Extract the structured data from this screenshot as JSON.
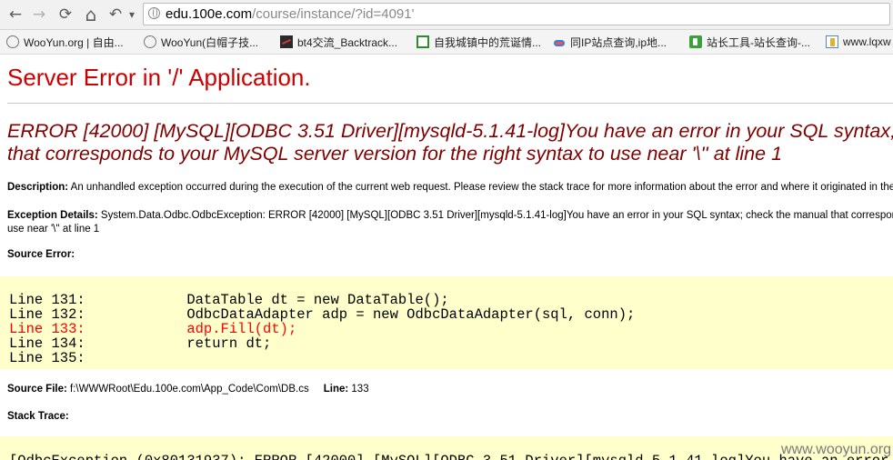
{
  "browser": {
    "url_host": "edu.100e.com",
    "url_path": "/course/instance/?id=4091'",
    "nav": {
      "back": "←",
      "forward": "→",
      "reload": "⟳",
      "home": "⌂",
      "history": "↶",
      "history_menu": "▾"
    },
    "bookmarks": [
      {
        "label": "WooYun.org | 自由...",
        "icon": "globe-icon"
      },
      {
        "label": "WooYun(白帽子技...",
        "icon": "globe-icon"
      },
      {
        "label": "bt4交流_Backtrack...",
        "icon": "bt-icon"
      },
      {
        "label": "自我城镇中的荒诞情...",
        "icon": "green-icon"
      },
      {
        "label": "同IP站点查询,ip地...",
        "icon": "cloud-icon"
      },
      {
        "label": "站长工具-站长查询-...",
        "icon": "tools-icon"
      },
      {
        "label": "www.lqxw",
        "icon": "book-icon"
      }
    ]
  },
  "page": {
    "title": "Server Error in '/' Application.",
    "error_line1": "ERROR [42000] [MySQL][ODBC 3.51 Driver][mysqld-5.1.41-log]You have an error in your SQL syntax; check the manual",
    "error_line2": "that corresponds to your MySQL server version for the right syntax to use near '\\'' at line 1",
    "description_label": "Description:",
    "description_text": " An unhandled exception occurred during the execution of the current web request. Please review the stack trace for more information about the error and where it originated in the code.",
    "exception_label": "Exception Details:",
    "exception_text1": " System.Data.Odbc.OdbcException: ERROR [42000] [MySQL][ODBC 3.51 Driver][mysqld-5.1.41-log]You have an error in your SQL syntax; check the manual that corresponds to your MySQL server version for the right syntax to",
    "exception_text2": "use near '\\'' at line 1",
    "source_error_label": "Source Error:",
    "code_lines": [
      {
        "text": "Line 131:            DataTable dt = new DataTable();",
        "highlight": false
      },
      {
        "text": "Line 132:            OdbcDataAdapter adp = new OdbcDataAdapter(sql, conn);",
        "highlight": false
      },
      {
        "text": "Line 133:            adp.Fill(dt);",
        "highlight": true
      },
      {
        "text": "Line 134:            return dt;",
        "highlight": false
      },
      {
        "text": "Line 135:",
        "highlight": false
      }
    ],
    "source_file_label": "Source File:",
    "source_file_value": " f:\\WWWRoot\\Edu.100e.com\\App_Code\\Com\\DB.cs",
    "line_label": "Line:",
    "line_value": " 133",
    "stack_trace_label": "Stack Trace:",
    "stack_line": "[OdbcException (0x80131937): ERROR [42000] [MySQL][ODBC 3.51 Driver][mysqld-5.1.41-log]You have an error in your SQL syntax;"
  },
  "watermark": "www.wooyun.org"
}
